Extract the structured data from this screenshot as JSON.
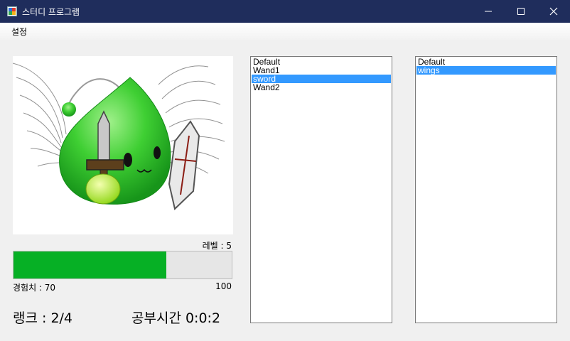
{
  "window": {
    "title": "스터디 프로그램"
  },
  "menu": {
    "items": [
      "설정"
    ]
  },
  "status": {
    "level_label": "레벨 : 5",
    "exp_label": "경험치 : 70",
    "exp_max_label": "100",
    "exp_progress": 0.7,
    "rank_label": "랭크 : 2/4",
    "study_time_label": "공부시간 0:0:2"
  },
  "weapons_list": {
    "items": [
      "Default",
      "Wand1",
      "sword",
      "Wand2"
    ],
    "selected_index": 2
  },
  "accessories_list": {
    "items": [
      "Default",
      "wings"
    ],
    "selected_index": 1
  },
  "colors": {
    "titlebar": "#1f2d5c",
    "progress_fill": "#06b025",
    "selection": "#3399ff"
  }
}
